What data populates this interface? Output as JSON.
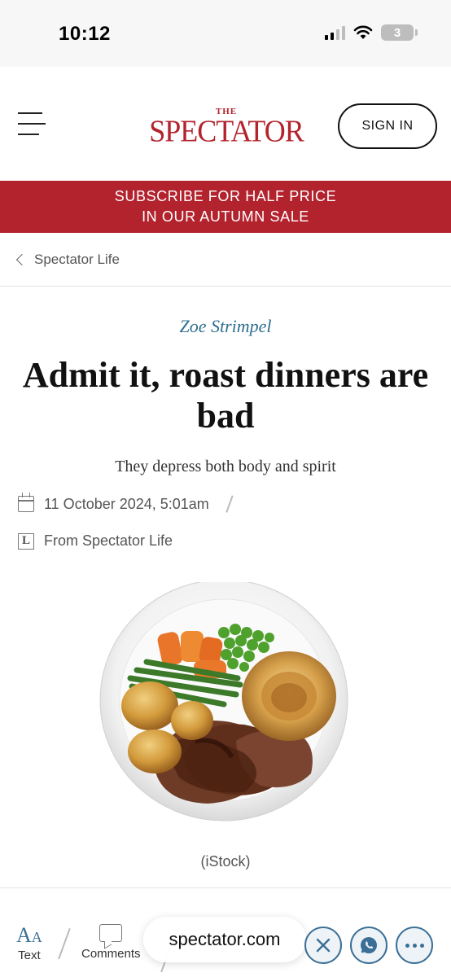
{
  "status_bar": {
    "time": "10:12",
    "battery": "3"
  },
  "header": {
    "logo_the": "THE",
    "logo_main": "SPECTATOR",
    "sign_in_label": "SIGN IN",
    "brand_color": "#b3232e"
  },
  "banner": {
    "line1": "SUBSCRIBE FOR HALF PRICE",
    "line2": "IN OUR AUTUMN SALE"
  },
  "breadcrumb": {
    "label": "Spectator Life"
  },
  "article": {
    "author": "Zoe Strimpel",
    "headline": "Admit it, roast dinners are bad",
    "standfirst": "They depress both body and spirit",
    "date": "11 October 2024, 5:01am",
    "source": "From Spectator Life",
    "image_caption": "(iStock)"
  },
  "toolbar": {
    "text_label": "Text",
    "comments_label": "Comments",
    "url": "spectator.com",
    "icons": [
      "text-size-icon",
      "comment-icon",
      "x-icon",
      "whatsapp-icon",
      "more-icon"
    ]
  }
}
